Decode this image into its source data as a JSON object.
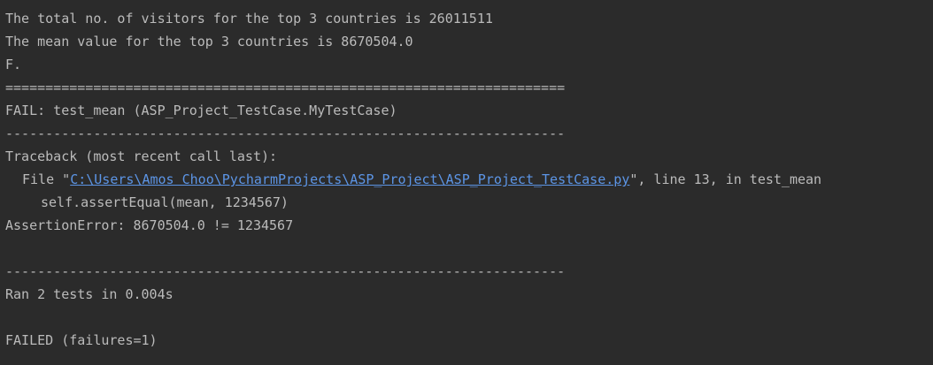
{
  "console": {
    "line1": "The total no. of visitors for the top 3 countries is 26011511",
    "line2": "The mean value for the top 3 countries is 8670504.0",
    "line3": "F.",
    "separator_double": "======================================================================",
    "fail_header": "FAIL: test_mean (ASP_Project_TestCase.MyTestCase)",
    "separator_single": "----------------------------------------------------------------------",
    "traceback_header": "Traceback (most recent call last):",
    "trace_file_prefix": "File \"",
    "trace_file_path": "C:\\Users\\Amos Choo\\PycharmProjects\\ASP_Project\\ASP_Project_TestCase.py",
    "trace_file_suffix": "\", line 13, in test_mean",
    "trace_code": "self.assertEqual(mean, 1234567)",
    "assertion_error": "AssertionError: 8670504.0 != 1234567",
    "separator_single_2": "----------------------------------------------------------------------",
    "ran_tests": "Ran 2 tests in 0.004s",
    "result": "FAILED (failures=1)"
  },
  "colors": {
    "background": "#2b2b2b",
    "text": "#bbbbbb",
    "link": "#5c95e6"
  }
}
